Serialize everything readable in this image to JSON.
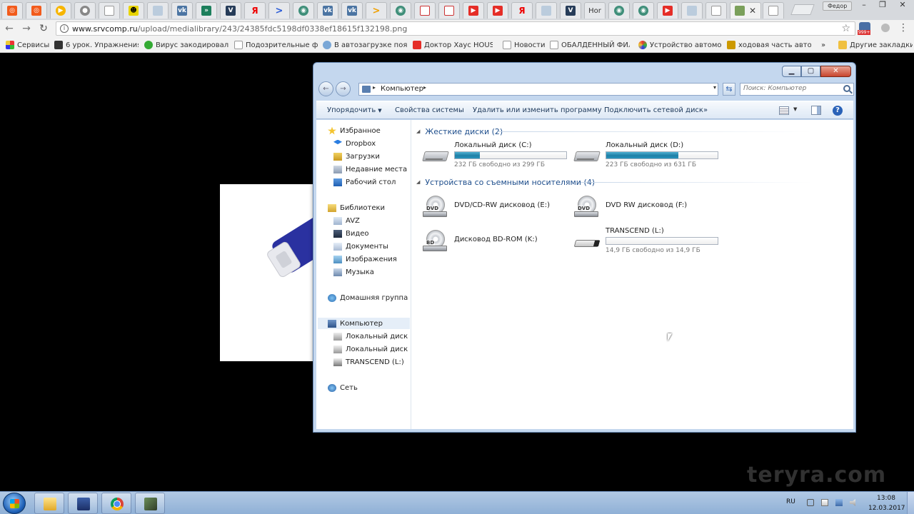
{
  "browser": {
    "active_tab_label": "",
    "tab_hor_label": "Hor",
    "profile_name": "Федор",
    "url_host": "www.srvcomp.ru",
    "url_path": "/upload/medialibrary/243/24385fdc5198df0338ef18615f132198.png",
    "extension_badge": "999+",
    "bookmarks": [
      "Сервисы",
      "6 урок. Упражнения",
      "Вирус закодировал с",
      "Подозрительные фа",
      "В автозагрузке появ",
      "Доктор Хаус HOUSE",
      "Новости",
      "ОБАЛДЕННЫЙ ФИЛ",
      "Устройство автомоб",
      "ходовая часть автом",
      "Другие закладки"
    ],
    "bookmarks_more": "»"
  },
  "explorer": {
    "breadcrumb": "Компьютер",
    "search_placeholder": "Поиск: Компьютер",
    "commands": {
      "organize": "Упорядочить",
      "system_properties": "Свойства системы",
      "uninstall": "Удалить или изменить программу",
      "map_drive": "Подключить сетевой диск",
      "more": "»"
    },
    "nav": {
      "favorites": "Избранное",
      "dropbox": "Dropbox",
      "downloads": "Загрузки",
      "recent": "Недавние места",
      "desktop": "Рабочий стол",
      "libraries": "Библиотеки",
      "avz": "AVZ",
      "video": "Видео",
      "documents": "Документы",
      "images": "Изображения",
      "music": "Музыка",
      "homegroup": "Домашняя группа",
      "computer": "Компьютер",
      "drive_c": "Локальный диск (C:)",
      "drive_d": "Локальный диск (D:)",
      "transcend": "TRANSCEND (L:)",
      "network": "Сеть"
    },
    "groups": {
      "hard_disks": "Жесткие диски (2)",
      "removable": "Устройства со съемными носителями (4)"
    },
    "drives": {
      "c": {
        "name": "Локальный диск (C:)",
        "free_text": "232 ГБ свободно из 299 ГБ",
        "used_fraction": 0.224
      },
      "d": {
        "name": "Локальный диск (D:)",
        "free_text": "223 ГБ свободно из 631 ГБ",
        "used_fraction": 0.647
      },
      "e": {
        "name": "DVD/CD-RW дисковод (E:)",
        "icon_label": "DVD"
      },
      "f": {
        "name": "DVD RW дисковод (F:)",
        "icon_label": "DVD"
      },
      "k": {
        "name": "Дисковод BD-ROM (K:)",
        "icon_label": "BD"
      },
      "l": {
        "name": "TRANSCEND (L:)",
        "free_text": "14,9 ГБ свободно из 14,9 ГБ",
        "used_fraction": 0.0
      }
    }
  },
  "watermark": "teryra.com",
  "taskbar": {
    "language": "RU",
    "time": "13:08",
    "date": "12.03.2017"
  },
  "colors": {
    "accent_link": "#1e4e8c",
    "drive_fill": "#1f7fa6",
    "window_frame": "#c4d7ee"
  }
}
